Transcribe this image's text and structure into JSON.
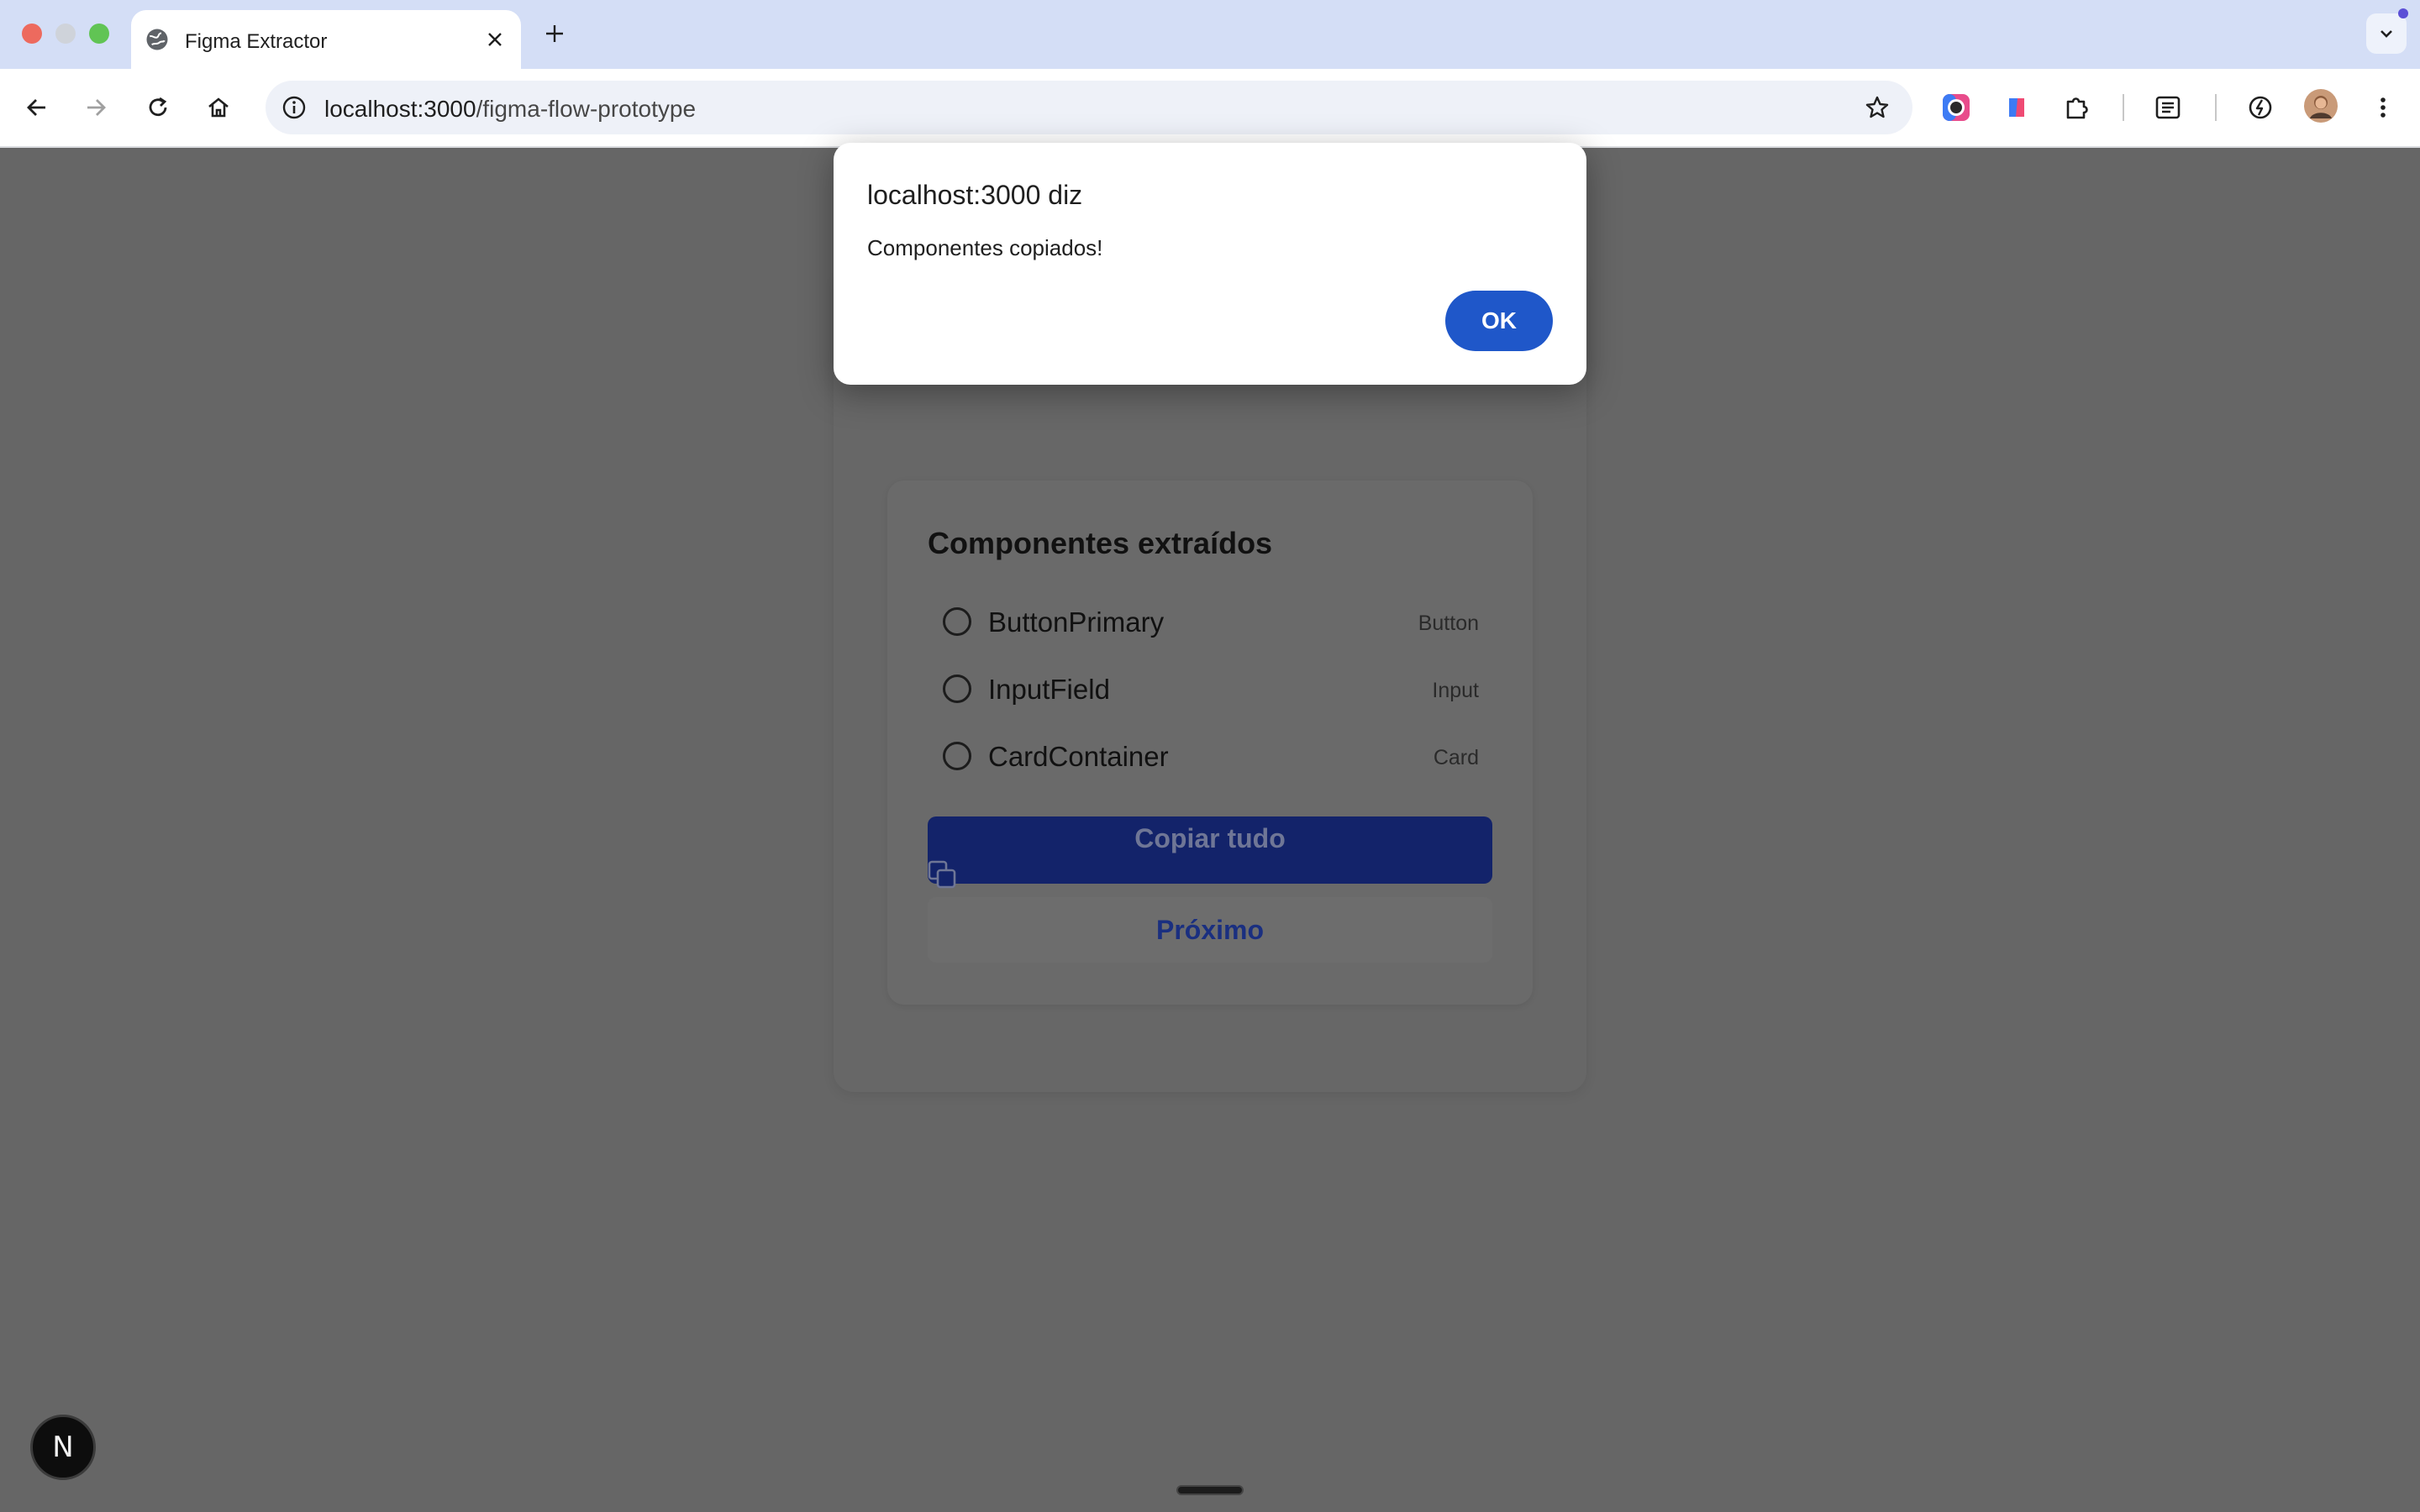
{
  "browser": {
    "tab": {
      "title": "Figma Extractor"
    },
    "omnibox": {
      "host": "localhost:3000",
      "path": "/figma-flow-prototype"
    }
  },
  "alert": {
    "title": "localhost:3000 diz",
    "message": "Componentes copiados!",
    "ok_label": "OK"
  },
  "panel": {
    "title": "Componentes extraídos",
    "components": [
      {
        "name": "ButtonPrimary",
        "type": "Button"
      },
      {
        "name": "InputField",
        "type": "Input"
      },
      {
        "name": "CardContainer",
        "type": "Card"
      }
    ],
    "copy_label": "Copiar tudo",
    "next_label": "Próximo"
  },
  "dev_badge": {
    "label": "N"
  },
  "colors": {
    "overlay": "#666666",
    "primary": "#1f57c9",
    "copy_button": "#13236a",
    "tabbar": "#d4def6"
  }
}
